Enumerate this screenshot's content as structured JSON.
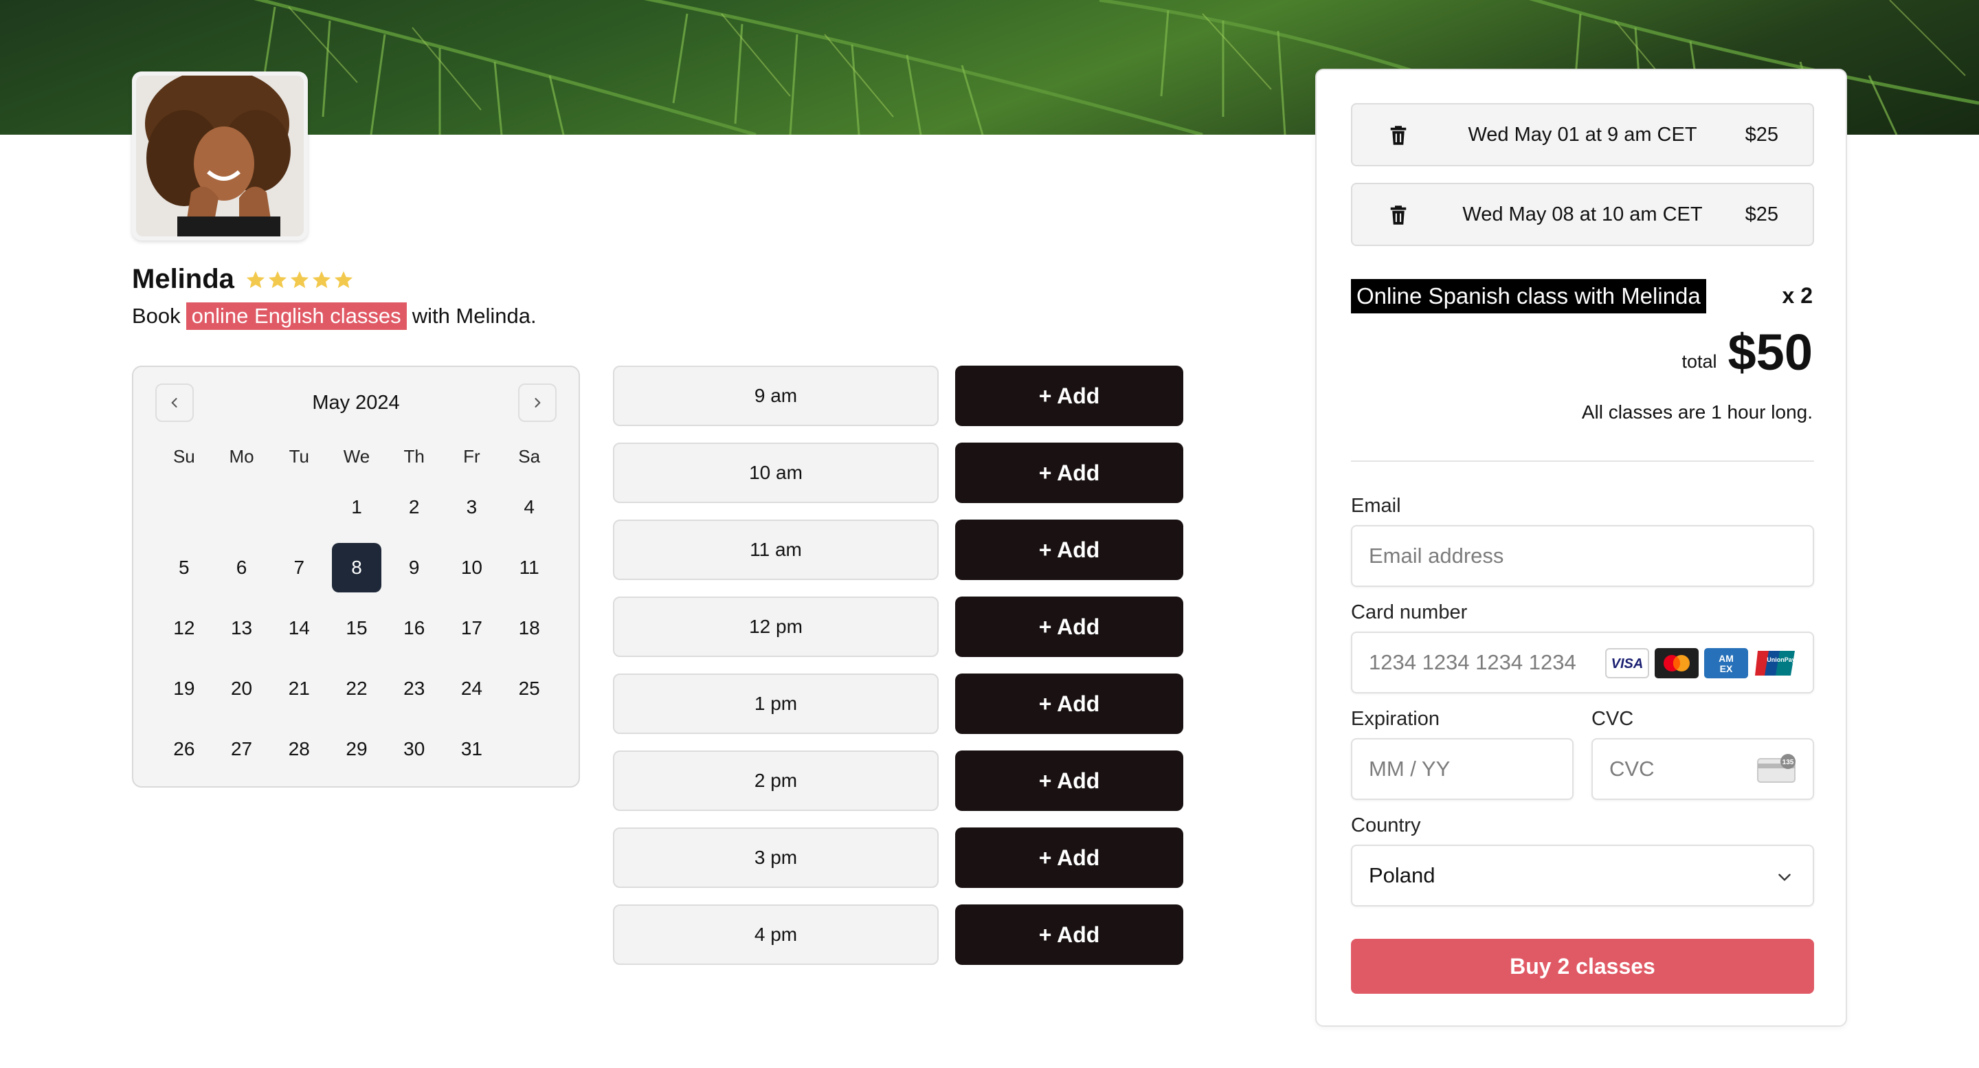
{
  "teacher": {
    "name": "Melinda",
    "rating": 5,
    "subtitle_prefix": "Book",
    "subtitle_highlight": "online English classes",
    "subtitle_suffix": "with Melinda."
  },
  "calendar": {
    "month_label": "May 2024",
    "weekdays": [
      "Su",
      "Mo",
      "Tu",
      "We",
      "Th",
      "Fr",
      "Sa"
    ],
    "days": [
      "",
      "",
      "",
      "1",
      "2",
      "3",
      "4",
      "5",
      "6",
      "7",
      "8",
      "9",
      "10",
      "11",
      "12",
      "13",
      "14",
      "15",
      "16",
      "17",
      "18",
      "19",
      "20",
      "21",
      "22",
      "23",
      "24",
      "25",
      "26",
      "27",
      "28",
      "29",
      "30",
      "31"
    ],
    "selected_day": "8"
  },
  "slots": [
    {
      "time": "9 am",
      "action": "+ Add"
    },
    {
      "time": "10 am",
      "action": "+ Add"
    },
    {
      "time": "11 am",
      "action": "+ Add"
    },
    {
      "time": "12 pm",
      "action": "+ Add"
    },
    {
      "time": "1 pm",
      "action": "+ Add"
    },
    {
      "time": "2 pm",
      "action": "+ Add"
    },
    {
      "time": "3 pm",
      "action": "+ Add"
    },
    {
      "time": "4 pm",
      "action": "+ Add"
    }
  ],
  "cart": {
    "bookings": [
      {
        "label": "Wed May 01 at 9 am CET",
        "price": "$25"
      },
      {
        "label": "Wed May 08 at 10 am CET",
        "price": "$25"
      }
    ],
    "product": "Online Spanish class with Melinda",
    "quantity": "x 2",
    "total_label": "total",
    "total_value": "$50",
    "duration_note": "All classes are 1 hour long."
  },
  "form": {
    "email_label": "Email",
    "email_placeholder": "Email address",
    "card_label": "Card number",
    "card_placeholder": "1234 1234 1234 1234",
    "card_brands": [
      "visa",
      "mastercard",
      "amex",
      "unionpay"
    ],
    "expiration_label": "Expiration",
    "expiration_placeholder": "MM / YY",
    "cvc_label": "CVC",
    "cvc_placeholder": "CVC",
    "cvc_icon_text": "135",
    "country_label": "Country",
    "country_value": "Poland",
    "buy_label": "Buy 2 classes"
  },
  "colors": {
    "accent": "#e05a66",
    "dark_button": "#1a1212",
    "selected_day": "#1e2838",
    "star": "#f2c94c"
  }
}
